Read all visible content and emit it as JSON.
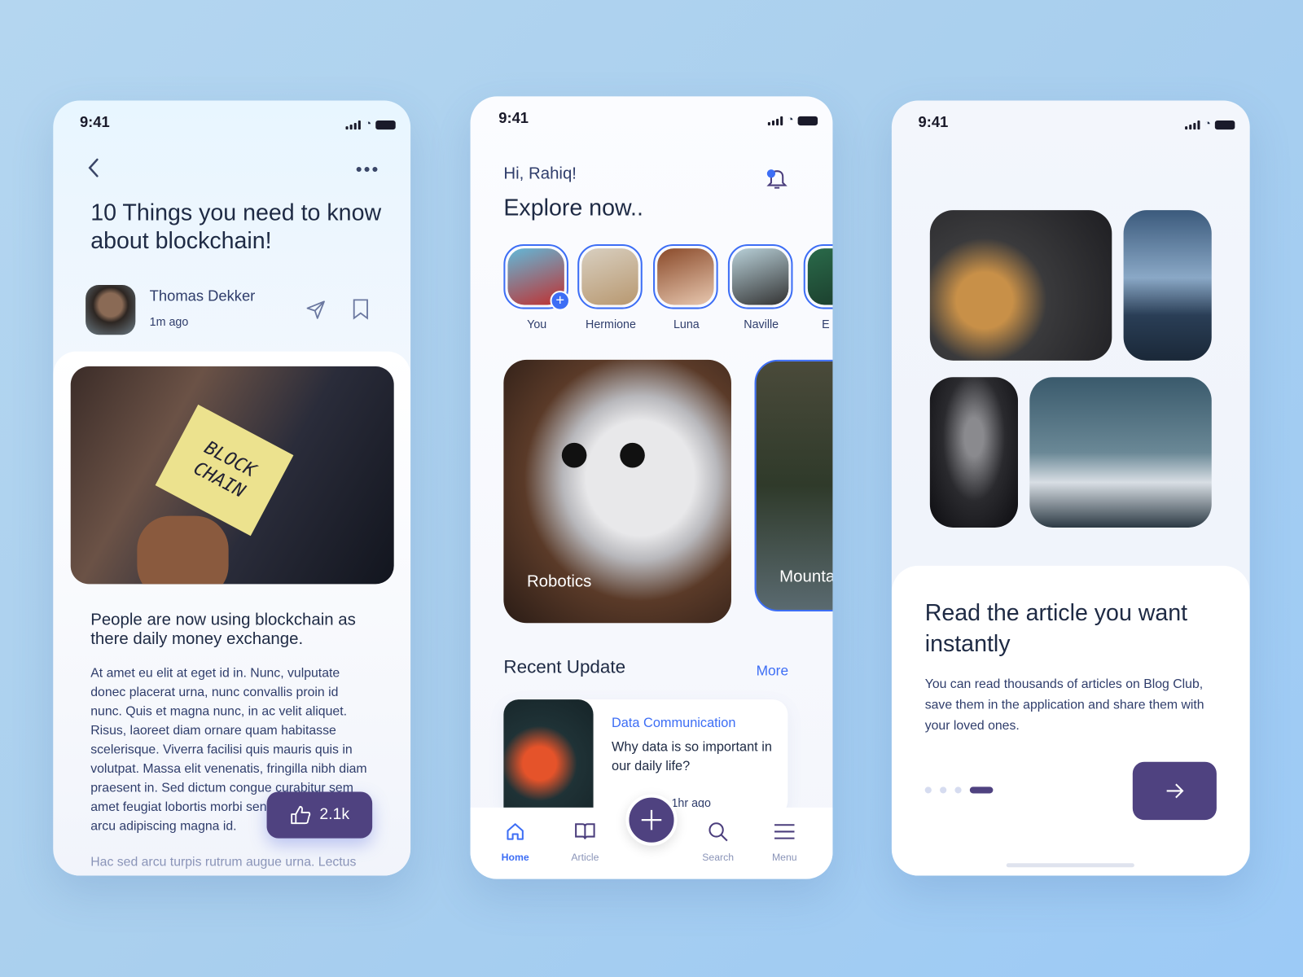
{
  "status_time": "9:41",
  "left": {
    "title": "10 Things you need to know about blockchain!",
    "author_name": "Thomas Dekker",
    "author_time": "1m ago",
    "image_note_text": "BLOCK CHAIN",
    "subtitle": "People are now using blockchain as there daily money exchange.",
    "body": "At amet eu elit at eget id in. Nunc, vulputate donec placerat urna, nunc convallis proin id nunc. Quis et magna nunc, in ac velit aliquet. Risus, laoreet diam ornare quam habitasse scelerisque. Viverra facilisi quis mauris quis in volutpat. Massa elit venenatis, fringilla nibh diam praesent in. Sed dictum congue curabitur sem amet feugiat lobortis morbi senectus vitae enim arcu adipiscing magna id.",
    "body_fade": "Hac sed arcu turpis rutrum augue urna. Lectus",
    "like_count": "2.1k"
  },
  "middle": {
    "greeting": "Hi, Rahiq!",
    "heading": "Explore now..",
    "stories": [
      {
        "label": "You"
      },
      {
        "label": "Hermione"
      },
      {
        "label": "Luna"
      },
      {
        "label": "Naville"
      },
      {
        "label": "E"
      }
    ],
    "categories": [
      {
        "label": "Robotics"
      },
      {
        "label": "Mounta"
      }
    ],
    "recent_title": "Recent Update",
    "more_label": "More",
    "post": {
      "category": "Data Communication",
      "title": "Why data is so important in our daily life?",
      "time": "1hr ago"
    },
    "nav": [
      {
        "label": "Home",
        "icon": "home-icon",
        "active": true
      },
      {
        "label": "Article",
        "icon": "book-icon"
      },
      {
        "label": "Search",
        "icon": "search-icon"
      },
      {
        "label": "Menu",
        "icon": "menu-icon"
      }
    ]
  },
  "right": {
    "heading": "Read the article you want instantly",
    "body": "You can read thousands of articles on Blog Club, save them in the application and share them with your loved ones.",
    "pages": 4,
    "active_page": 4
  },
  "colors": {
    "accent": "#4a3d7c",
    "blue": "#3d6ef5",
    "text": "#1e2a44",
    "muted": "#2f3d6b"
  }
}
